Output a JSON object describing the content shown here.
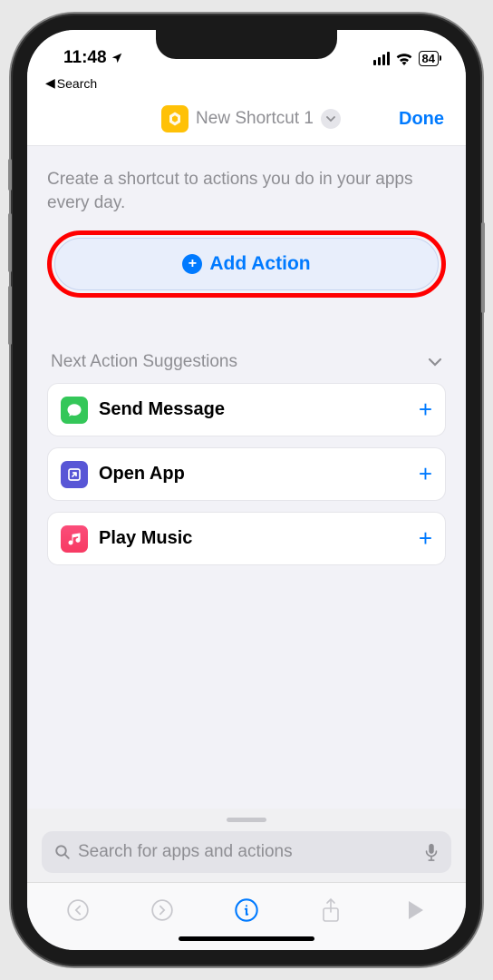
{
  "status": {
    "time": "11:48",
    "battery": "84"
  },
  "back_link": "Search",
  "nav": {
    "title": "New Shortcut 1",
    "done": "Done"
  },
  "intro": "Create a shortcut to actions you do in your apps every day.",
  "add_action": "Add Action",
  "suggestions": {
    "header": "Next Action Suggestions",
    "items": [
      {
        "label": "Send Message",
        "icon": "message-icon"
      },
      {
        "label": "Open App",
        "icon": "open-app-icon"
      },
      {
        "label": "Play Music",
        "icon": "music-icon"
      }
    ]
  },
  "search": {
    "placeholder": "Search for apps and actions"
  }
}
